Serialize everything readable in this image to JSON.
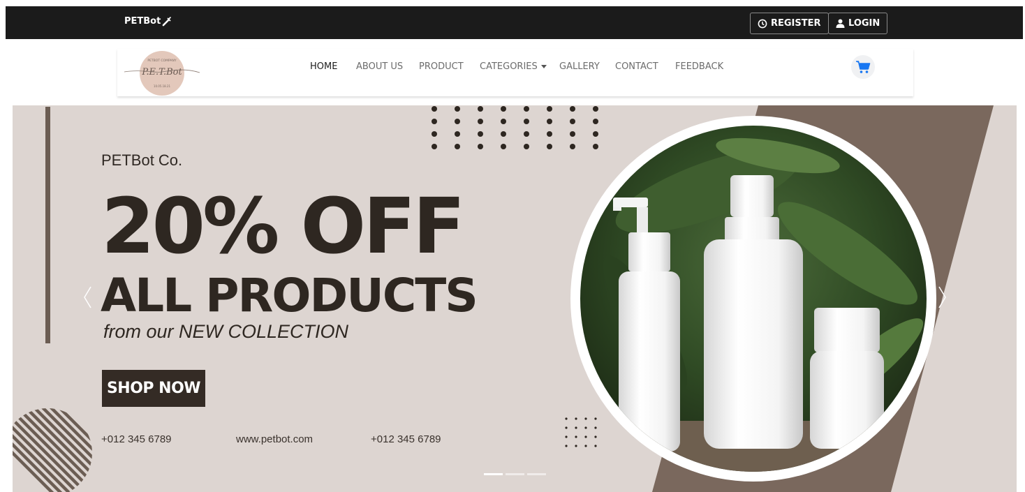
{
  "topbar": {
    "brand": "PETBot",
    "register_label": "REGISTER",
    "login_label": "LOGIN"
  },
  "nav": {
    "logo_alt": "PETBot Company logo",
    "links": [
      {
        "label": "HOME",
        "active": true
      },
      {
        "label": "ABOUT US",
        "active": false
      },
      {
        "label": "PRODUCT",
        "active": false
      },
      {
        "label": "CATEGORIES",
        "active": false,
        "dropdown": true
      },
      {
        "label": "GALLERY",
        "active": false
      },
      {
        "label": "CONTACT",
        "active": false
      },
      {
        "label": "FEEDBACK",
        "active": false
      }
    ],
    "cart_icon": "shopping-cart-icon"
  },
  "hero": {
    "company": "PETBot Co.",
    "headline_line1": "20% OFF",
    "headline_line2": "ALL PRODUCTS",
    "tagline": "from our NEW COLLECTION",
    "cta_label": "SHOP NOW",
    "phone_1": "+012 345 6789",
    "website": "www.petbot.com",
    "phone_2": "+012 345 6789",
    "slide_count": 3,
    "active_slide": 1
  },
  "colors": {
    "topbar_bg": "#1b1b1b",
    "hero_bg": "#ddd5d1",
    "accent_brown": "#7a685d",
    "dark_brown": "#2e2721",
    "cart_blue": "#1877f2"
  }
}
